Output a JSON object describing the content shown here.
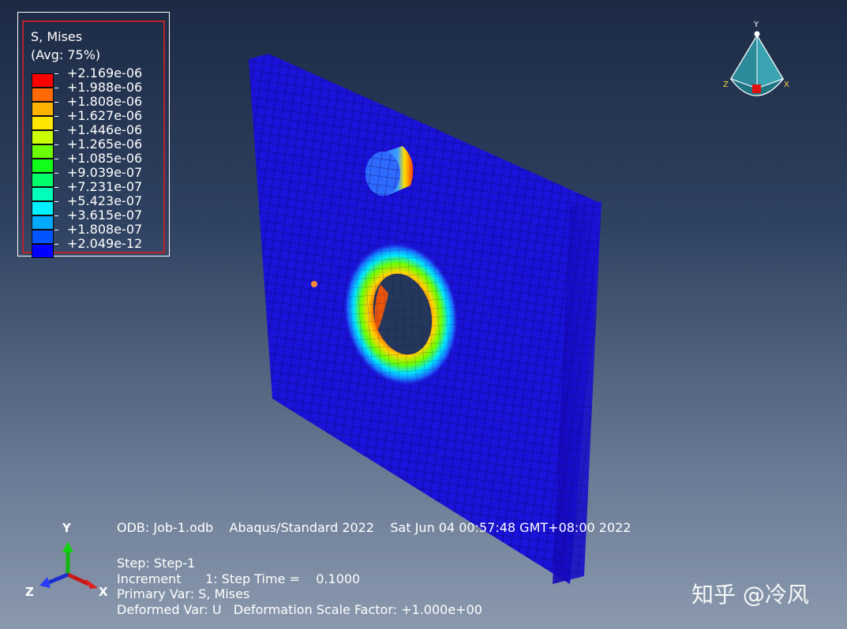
{
  "legend": {
    "title": "S, Mises",
    "subtitle": "(Avg: 75%)",
    "values": [
      "+2.169e-06",
      "+1.988e-06",
      "+1.808e-06",
      "+1.627e-06",
      "+1.446e-06",
      "+1.265e-06",
      "+1.085e-06",
      "+9.039e-07",
      "+7.231e-07",
      "+5.423e-07",
      "+3.615e-07",
      "+1.808e-07",
      "+2.049e-12"
    ],
    "colors": [
      "#ff0000",
      "#ff6a00",
      "#ffb300",
      "#ffe600",
      "#c9ff00",
      "#6cff00",
      "#12ff1a",
      "#00ff6a",
      "#00ffb8",
      "#00f0ff",
      "#00a8ff",
      "#0055ff",
      "#0000ff"
    ]
  },
  "info": {
    "line1": "ODB: Job-1.odb    Abaqus/Standard 2022    Sat Jun 04 00:57:48 GMT+08:00 2022",
    "line2": "Step: Step-1",
    "line3": "Increment      1: Step Time =    0.1000",
    "line4": "Primary Var: S, Mises",
    "line5": "Deformed Var: U   Deformation Scale Factor: +1.000e+00"
  },
  "triad": {
    "y": "Y",
    "z": "Z",
    "x": "X"
  },
  "view_cube": {
    "y": "Y",
    "z": "Z",
    "x": "X"
  },
  "watermark": "知乎 @冷风",
  "colors": {
    "plate": "#1a12d8",
    "mesh": "#050566",
    "marker": "#ff8c3a"
  }
}
